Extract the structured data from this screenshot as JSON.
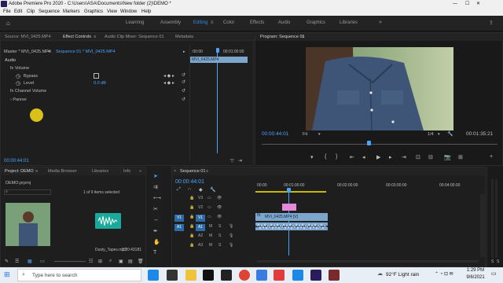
{
  "title": "Adobe Premiere Pro 2020 - C:\\Users\\ASA\\Documents\\New folder (2)\\DEMO *",
  "menu": [
    "File",
    "Edit",
    "Clip",
    "Sequence",
    "Markers",
    "Graphics",
    "View",
    "Window",
    "Help"
  ],
  "workspaces": [
    "Learning",
    "Assembly",
    "Editing",
    "Color",
    "Effects",
    "Audio",
    "Graphics",
    "Libraries"
  ],
  "active_workspace": "Editing",
  "source_panel": {
    "tabs": [
      "Source: MVI_0425.MP4",
      "Effect Controls",
      "Audio Clip Mixer: Sequence 01",
      "Metadata"
    ],
    "master": "Master * MVI_0425.MP4",
    "sequence": "Sequence 01 * MVI_0425.MP4",
    "section": "Audio",
    "effects": [
      "Volume",
      "Bypass",
      "Level",
      "Channel Volume",
      "Panner"
    ],
    "level_value": "0.0 dB",
    "ruler_start": ":00:00",
    "ruler_end": "00:01:00:00",
    "clip_name": "MVI_0425.MP4",
    "timecode": "00:00:44:01"
  },
  "program_panel": {
    "title": "Program: Sequence 01",
    "timecode": "00:00:44:01",
    "fit": "Fit",
    "resolution": "1/4",
    "duration": "00:01:35:21"
  },
  "project_panel": {
    "tabs": [
      "Project: DEMO",
      "Media Browser",
      "Libraries",
      "Info"
    ],
    "file": "DEMO.prproj",
    "items_selected": "1 of 9 items selected",
    "item_label": "Dusty_Tapes.mp3",
    "item_duration": "2:20:43181"
  },
  "sequence_panel": {
    "title": "Sequence 01",
    "timecode": "00:00:44:01",
    "ruler": [
      "00:00",
      "00:01:00:00",
      "00:02:00:00",
      "00:03:00:00",
      "00:04:00:00"
    ],
    "tracks": [
      "V3",
      "V2",
      "V1",
      "A1",
      "A2",
      "A3"
    ],
    "source_patch": [
      "V1",
      "A1"
    ],
    "clip_label": "MVI_0425.MP4 [V]"
  },
  "taskbar": {
    "search_placeholder": "Type here to search",
    "weather": "92°F  Light rain",
    "time": "1:29 PM",
    "date": "9/6/2021"
  }
}
